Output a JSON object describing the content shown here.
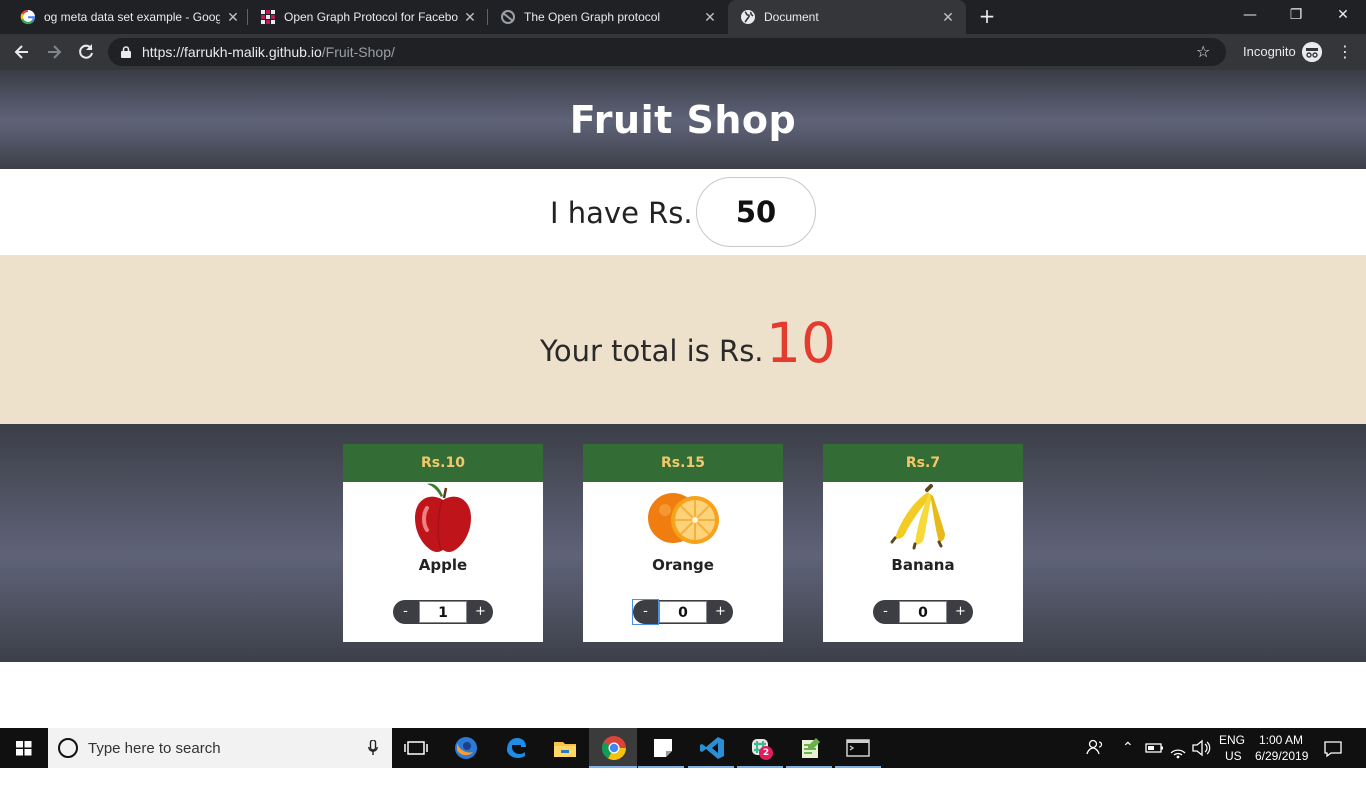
{
  "browser": {
    "tabs": [
      {
        "label": "og meta data set example - Goog",
        "active": false
      },
      {
        "label": "Open Graph Protocol for Facebo",
        "active": false
      },
      {
        "label": "The Open Graph protocol",
        "active": false
      },
      {
        "label": "Document",
        "active": true
      }
    ],
    "url_host": "https://farrukh-malik.github.io",
    "url_path": "/Fruit-Shop/",
    "profile_label": "Incognito"
  },
  "page": {
    "title": "Fruit Shop",
    "budget": {
      "label": "I have Rs.",
      "value": "50"
    },
    "total": {
      "label": "Your total is Rs.",
      "value": "10"
    },
    "products": [
      {
        "price": "Rs.10",
        "name": "Apple",
        "qty": "1",
        "icon": "apple-icon"
      },
      {
        "price": "Rs.15",
        "name": "Orange",
        "qty": "0",
        "icon": "orange-icon"
      },
      {
        "price": "Rs.7",
        "name": "Banana",
        "qty": "0",
        "icon": "banana-icon"
      }
    ],
    "stepper": {
      "minus": "-",
      "plus": "+"
    }
  },
  "taskbar": {
    "search_placeholder": "Type here to search",
    "lang_top": "ENG",
    "lang_bottom": "US",
    "time": "1:00 AM",
    "date": "6/29/2019",
    "slack_badge": "2"
  },
  "colors": {
    "accent_total": "#e33b2e",
    "price_bar": "#336c34",
    "price_text": "#f4c86a",
    "total_band": "#eee1cc"
  }
}
